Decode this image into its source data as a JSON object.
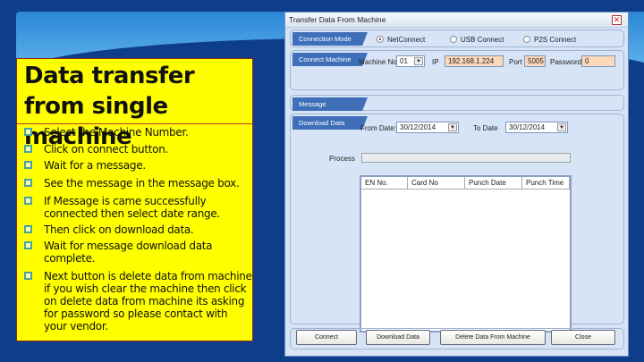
{
  "slide": {
    "title": "Data transfer from single machine",
    "bullets": [
      "Select the Machine Number.",
      "Click on connect button.",
      "Wait for a message.",
      "See the message in the message box.",
      "If Message is came successfully connected then select date range.",
      "Then click on download data.",
      "Wait for message download data complete.",
      "Next button is delete data from machine if you wish clear the machine then click on delete data from machine its asking for password so please contact with your vendor."
    ]
  },
  "dialog": {
    "title": "Transfer Data From Machine",
    "connection_mode": {
      "label": "Connection Mode",
      "options": [
        "NetConnect",
        "USB Connect",
        "P2S Connect"
      ],
      "selected": "NetConnect"
    },
    "connect_machine": {
      "label": "Connect Machine",
      "machine_no_label": "Machine No.",
      "machine_no": "01",
      "ip_label": "IP",
      "ip": "192.168.1.224",
      "port_label": "Port",
      "port": "5005",
      "password_label": "Password",
      "password": "0"
    },
    "message": {
      "label": "Message"
    },
    "download": {
      "label": "Download Data",
      "from_label": "From Date:",
      "from": "30/12/2014",
      "to_label": "To Date",
      "to": "30/12/2014",
      "process_label": "Process",
      "columns": [
        "EN No.",
        "Card No",
        "Punch Date",
        "Punch Time"
      ]
    },
    "buttons": [
      "Connect",
      "Download Data",
      "Delete Data From Machine",
      "Close"
    ]
  }
}
